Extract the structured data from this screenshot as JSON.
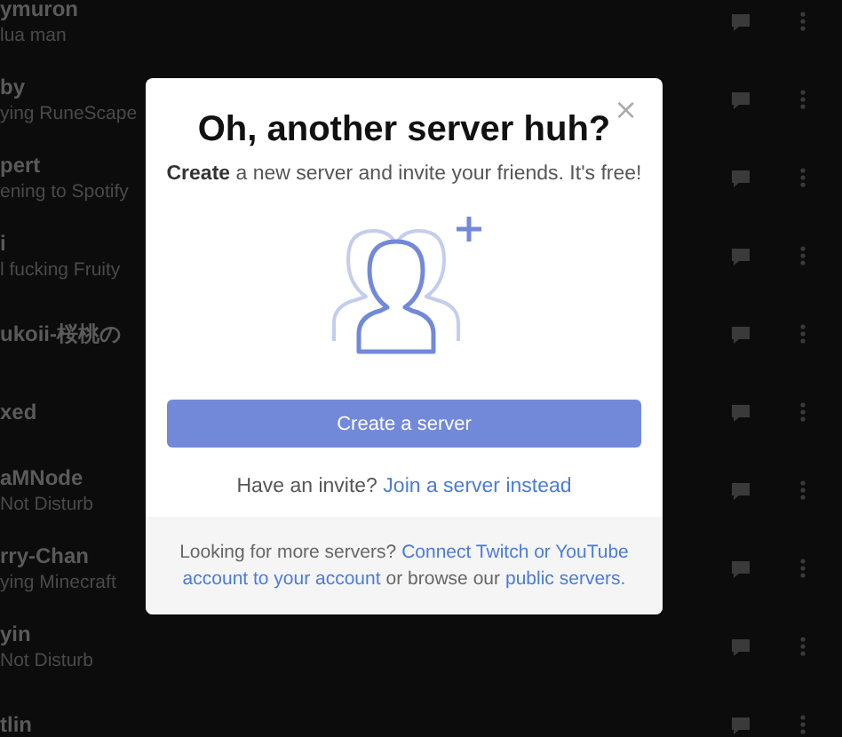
{
  "friends": [
    {
      "name": "ymuron",
      "status": "lua man"
    },
    {
      "name": "by",
      "status": "ying RuneScape"
    },
    {
      "name": "pert",
      "status": "ening to Spotify"
    },
    {
      "name": "i",
      "status": "l fucking Fruity"
    },
    {
      "name": "ukoii-桜桃の"
    },
    {
      "name": "xed"
    },
    {
      "name": "aMNode",
      "status": "Not Disturb"
    },
    {
      "name": "rry-Chan",
      "status": "ying Minecraft"
    },
    {
      "name": "yin",
      "status": "Not Disturb"
    },
    {
      "name": "tlin"
    }
  ],
  "modal": {
    "title": "Oh, another server huh?",
    "subtitle": "**Create** a new server and invite your friends. It's free!",
    "close": "×",
    "create_button": "Create a server",
    "invite_text": "Have an invite?",
    "invite_link": "Join a server instead",
    "footer": [
      {
        "kind": "text",
        "text": "Looking for more servers?"
      },
      {
        "kind": "link",
        "text": "Connect Twitch or YouTube"
      },
      {
        "kind": "break"
      },
      {
        "kind": "link",
        "text": "account to your account"
      },
      {
        "kind": "text",
        "text": "or browse our"
      },
      {
        "kind": "link",
        "text": "public servers."
      }
    ]
  }
}
